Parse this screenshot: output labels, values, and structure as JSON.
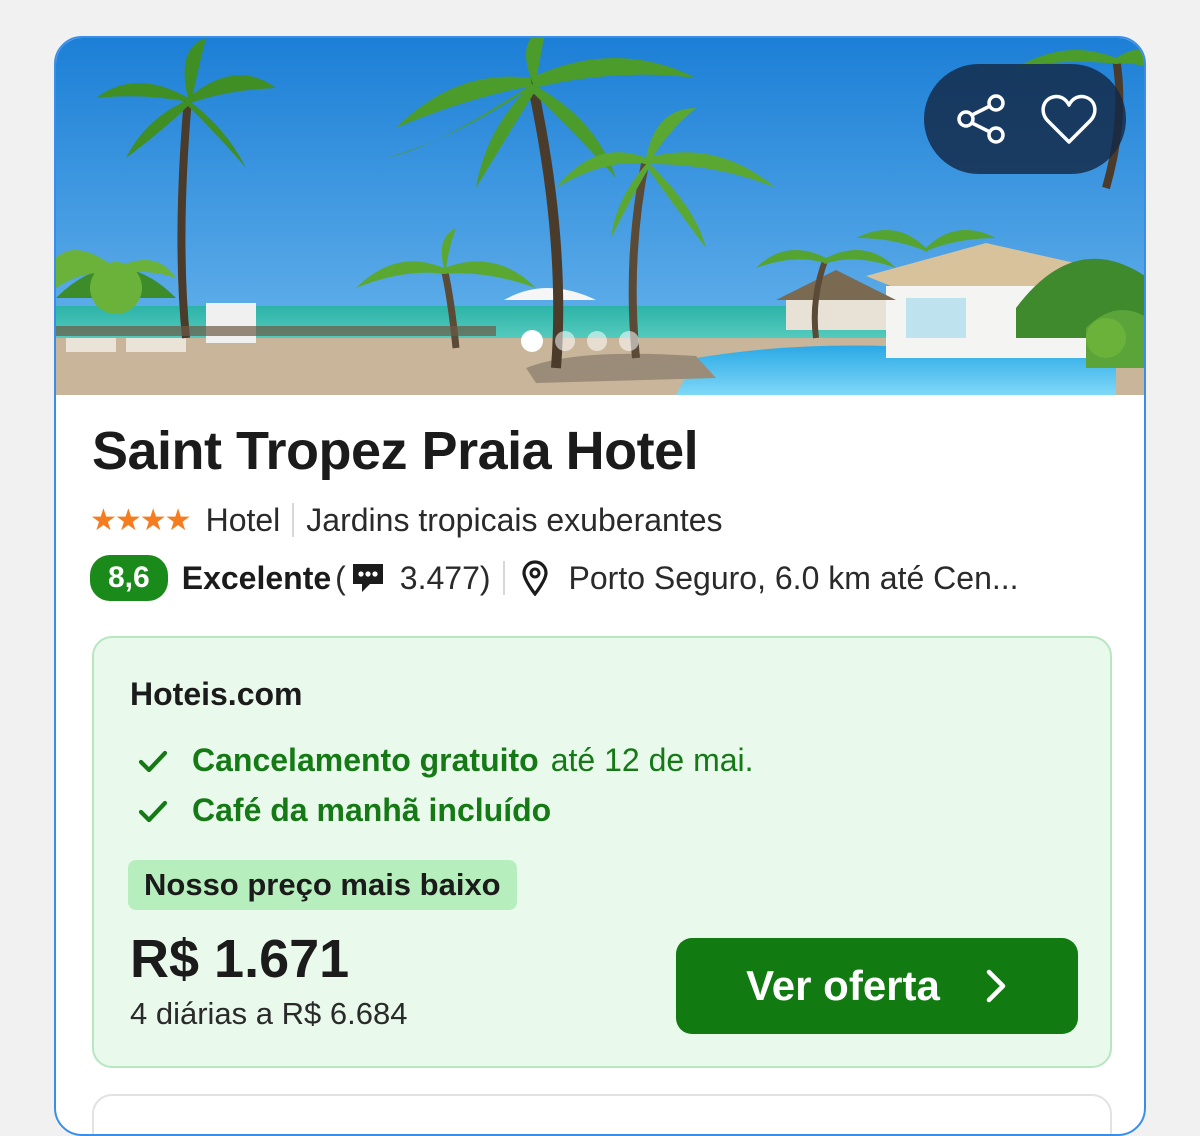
{
  "hotel": {
    "name": "Saint Tropez Praia Hotel",
    "stars_display": "★★★★",
    "star_count": 4,
    "type": "Hotel",
    "highlight": "Jardins tropicais exuberantes",
    "score": "8,6",
    "rating_label": "Excelente",
    "open_paren": "(",
    "review_count": "3.477)",
    "location": "Porto Seguro, 6.0 km até Cen..."
  },
  "gallery": {
    "total_images": 4,
    "active_index": 0
  },
  "actions": {
    "share_icon": "share-icon",
    "favorite_icon": "heart-icon"
  },
  "offer": {
    "provider": "Hoteis.com",
    "features": [
      {
        "strong": "Cancelamento gratuito",
        "soft": "até 12 de mai."
      },
      {
        "strong": "Café da manhã incluído",
        "soft": ""
      }
    ],
    "badge": "Nosso preço mais baixo",
    "price": "R$ 1.671",
    "nights_total": "4 diárias a R$ 6.684",
    "cta_label": "Ver oferta"
  },
  "colors": {
    "accent_green": "#117a11",
    "score_green": "#1a8a1a",
    "offer_bg": "#e9f9ec",
    "badge_bg": "#b6efbd",
    "star_orange": "#f57c1f",
    "card_border": "#3b8ee8"
  }
}
